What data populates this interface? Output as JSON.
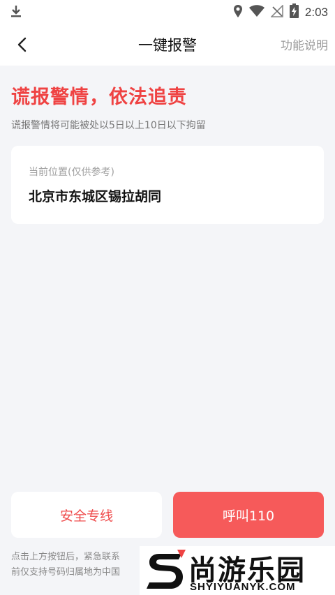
{
  "status_bar": {
    "time": "2:03",
    "icons": [
      "download-icon",
      "location-icon",
      "wifi-icon",
      "no-signal-icon",
      "battery-charging-icon"
    ]
  },
  "nav": {
    "title": "一键报警",
    "help": "功能说明"
  },
  "warning": {
    "title": "谎报警情，依法追责",
    "subtitle": "谎报警情将可能被处以5日以上10日以下拘留"
  },
  "location": {
    "label": "当前位置(仅供参考)",
    "value": "北京市东城区锡拉胡同"
  },
  "buttons": {
    "safe_line": "安全专线",
    "call": "呼叫110"
  },
  "notice": {
    "line1": "点击上方按钮后，紧急联系",
    "line2": "前仅支持号码归属地为中国"
  },
  "watermark": {
    "cn": "尚游乐园",
    "en": "SHYIYUANYK.COM"
  },
  "colors": {
    "accent": "#ef4343",
    "call_button": "#f65a5a",
    "background": "#f4f5f8"
  }
}
